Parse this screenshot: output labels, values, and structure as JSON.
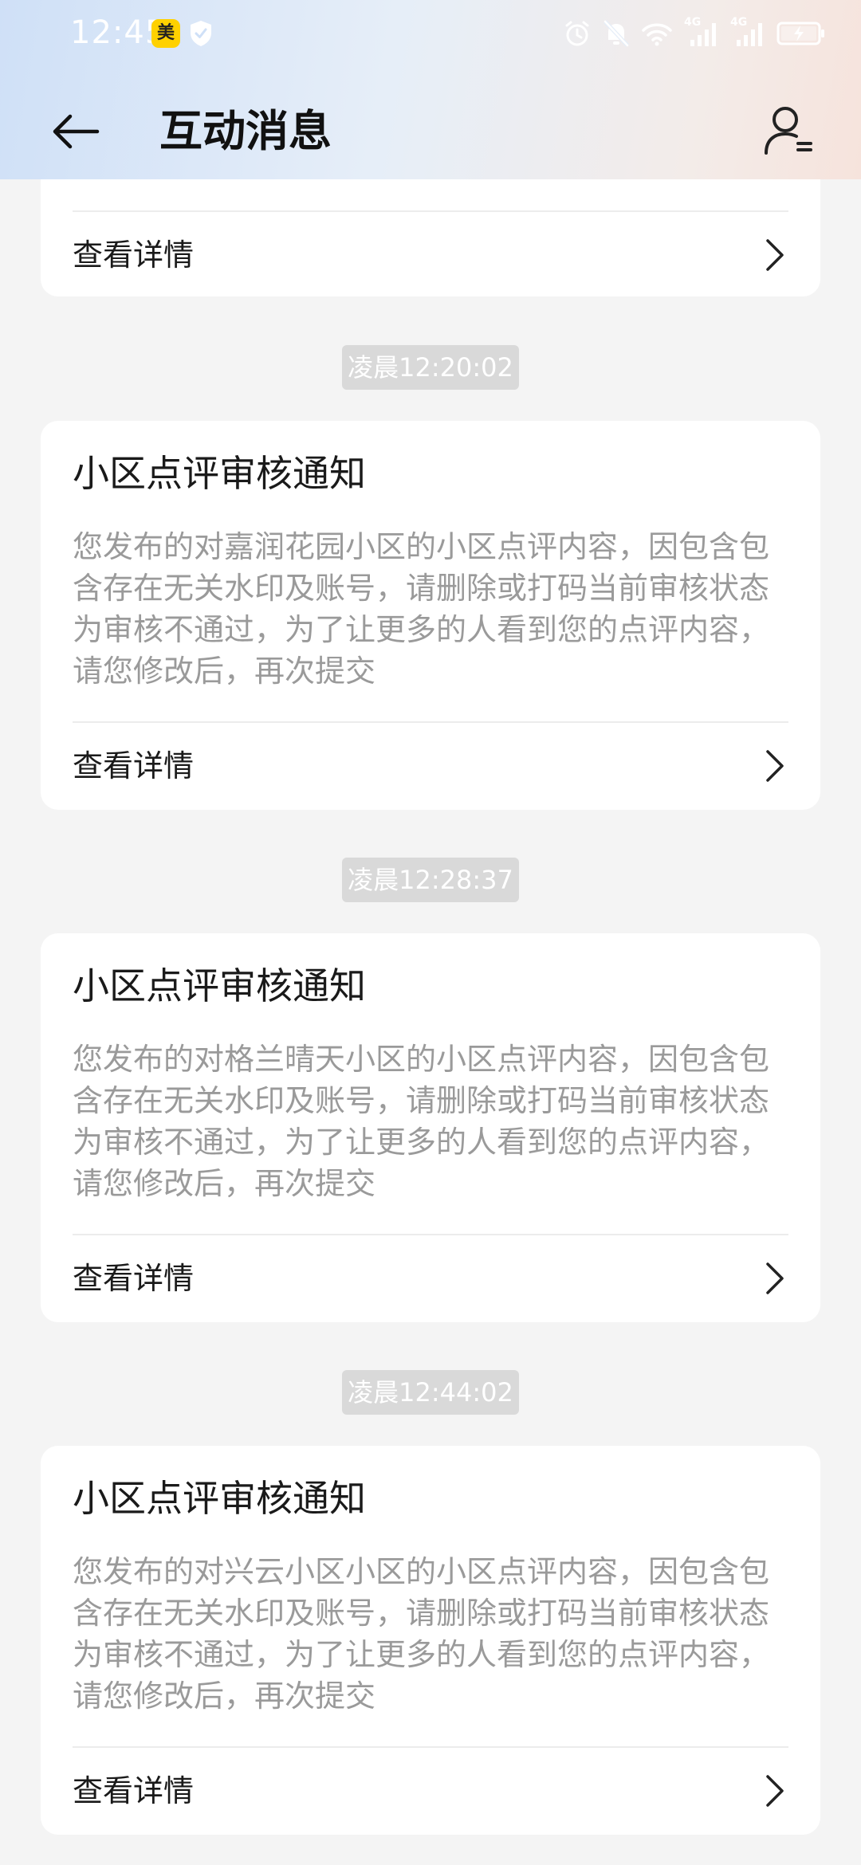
{
  "status_bar": {
    "time": "12:45",
    "app_badge": "美",
    "network_label_1": "4G",
    "network_label_2": "4G"
  },
  "nav": {
    "title": "互动消息"
  },
  "partial_card": {
    "detail_label": "查看详情"
  },
  "messages": [
    {
      "timestamp": "凌晨12:20:02",
      "title": "小区点评审核通知",
      "body": "您发布的对嘉润花园小区的小区点评内容，因包含包含存在无关水印及账号，请删除或打码当前审核状态为审核不通过，为了让更多的人看到您的点评内容，请您修改后，再次提交",
      "detail_label": "查看详情"
    },
    {
      "timestamp": "凌晨12:28:37",
      "title": "小区点评审核通知",
      "body": "您发布的对格兰晴天小区的小区点评内容，因包含包含存在无关水印及账号，请删除或打码当前审核状态为审核不通过，为了让更多的人看到您的点评内容，请您修改后，再次提交",
      "detail_label": "查看详情"
    },
    {
      "timestamp": "凌晨12:44:02",
      "title": "小区点评审核通知",
      "body": "您发布的对兴云小区小区的小区点评内容，因包含包含存在无关水印及账号，请删除或打码当前审核状态为审核不通过，为了让更多的人看到您的点评内容，请您修改后，再次提交",
      "detail_label": "查看详情"
    }
  ],
  "icons": {
    "back": "arrow-left",
    "profile": "user-list",
    "chevron": "chevron-right"
  },
  "colors": {
    "badge": "#ffd100",
    "background": "#f4f4f4",
    "card": "#ffffff",
    "timestamp_pill": "#d9d9d9",
    "body_text": "#9a9a9a"
  }
}
